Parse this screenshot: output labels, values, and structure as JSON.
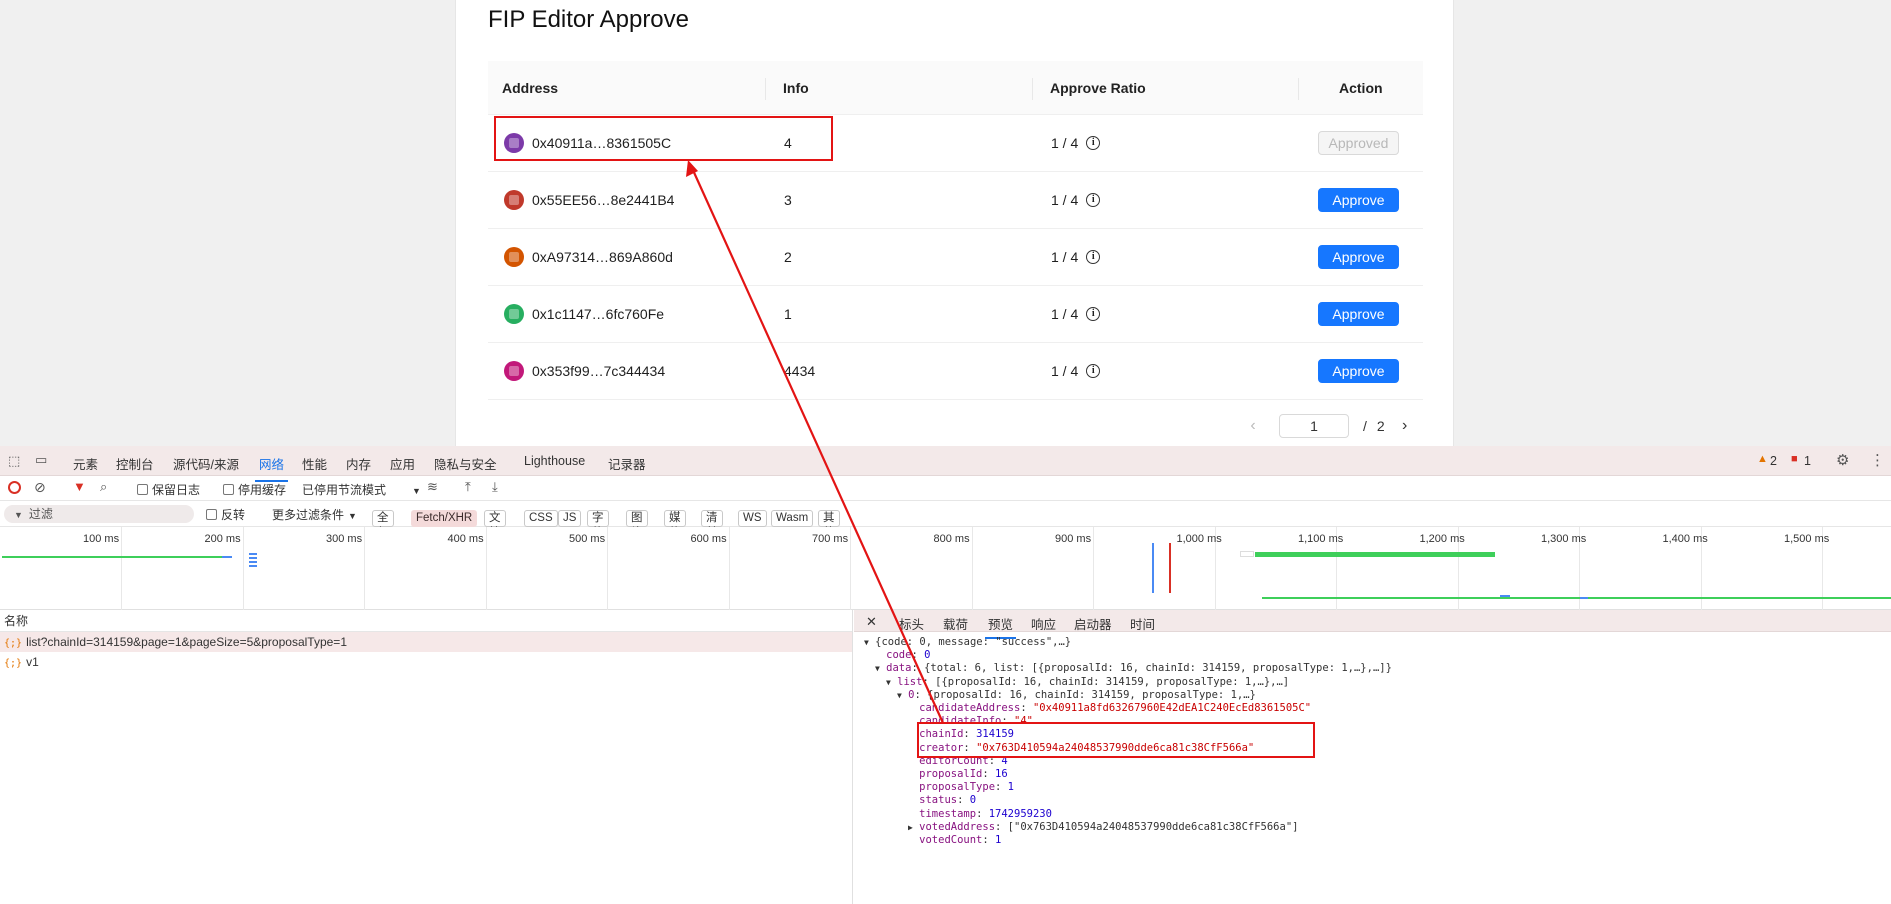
{
  "page": {
    "title": "FIP Editor Approve",
    "table": {
      "columns": [
        "Address",
        "Info",
        "Approve Ratio",
        "Action"
      ],
      "rows": [
        {
          "address": "0x40911a…8361505C",
          "info": "4",
          "ratio": "1 / 4",
          "action": "Approved",
          "state": "approved",
          "avatar_color": "#7c3aa8"
        },
        {
          "address": "0x55EE56…8e2441B4",
          "info": "3",
          "ratio": "1 / 4",
          "action": "Approve",
          "state": "approve",
          "avatar_color": "#c0392b"
        },
        {
          "address": "0xA97314…869A860d",
          "info": "2",
          "ratio": "1 / 4",
          "action": "Approve",
          "state": "approve",
          "avatar_color": "#d35400"
        },
        {
          "address": "0x1c1147…6fc760Fe",
          "info": "1",
          "ratio": "1 / 4",
          "action": "Approve",
          "state": "approve",
          "avatar_color": "#27ae60"
        },
        {
          "address": "0x353f99…7c344434",
          "info": "4434",
          "ratio": "1 / 4",
          "action": "Approve",
          "state": "approve",
          "avatar_color": "#c2187a"
        }
      ]
    },
    "pagination": {
      "prev_icon": "‹",
      "current": "1",
      "separator": "/",
      "total": "2",
      "next_icon": "›"
    }
  },
  "devtools": {
    "tabs": [
      "元素",
      "控制台",
      "源代码/来源",
      "网络",
      "性能",
      "内存",
      "应用",
      "隐私与安全",
      "Lighthouse",
      "记录器"
    ],
    "active_tab": "网络",
    "warnings": "2",
    "errors": "1",
    "toolbar": {
      "preserve_log": "保留日志",
      "disable_cache": "停用缓存",
      "throttle": "已停用节流模式"
    },
    "filter": {
      "placeholder": "过滤",
      "invert": "反转",
      "more_filters": "更多过滤条件",
      "chips": [
        "全部",
        "Fetch/XHR",
        "文档",
        "CSS",
        "JS",
        "字体",
        "图片",
        "媒体",
        "清单",
        "WS",
        "Wasm",
        "其他"
      ],
      "active_chip": "Fetch/XHR"
    },
    "timeline_labels": [
      "100 ms",
      "200 ms",
      "300 ms",
      "400 ms",
      "500 ms",
      "600 ms",
      "700 ms",
      "800 ms",
      "900 ms",
      "1,000 ms",
      "1,100 ms",
      "1,200 ms",
      "1,300 ms",
      "1,400 ms",
      "1,500 ms"
    ],
    "requests": {
      "header": "名称",
      "items": [
        "list?chainId=314159&page=1&pageSize=5&proposalType=1",
        "v1"
      ]
    },
    "detail": {
      "close_icon": "✕",
      "tabs": [
        "标头",
        "载荷",
        "预览",
        "响应",
        "启动器",
        "时间"
      ],
      "active_tab": "预览",
      "json_lines": [
        {
          "indent": 0,
          "tri": "▼",
          "text": "{code: 0, message: \"success\",…}"
        },
        {
          "indent": 1,
          "key": "code",
          "num": "0"
        },
        {
          "indent": 1,
          "tri": "▼",
          "key": "data",
          "text": "{total: 6, list: [{proposalId: 16, chainId: 314159, proposalType: 1,…},…]}"
        },
        {
          "indent": 2,
          "tri": "▼",
          "key": "list",
          "text": "[{proposalId: 16, chainId: 314159, proposalType: 1,…},…]"
        },
        {
          "indent": 3,
          "tri": "▼",
          "key": "0",
          "text": "{proposalId: 16, chainId: 314159, proposalType: 1,…}"
        },
        {
          "indent": 4,
          "key": "candidateAddress",
          "str": "\"0x40911a8fd63267960E42dEA1C240EcEd8361505C\""
        },
        {
          "indent": 4,
          "key": "candidateInfo",
          "str": "\"4\""
        },
        {
          "indent": 4,
          "key": "chainId",
          "num": "314159"
        },
        {
          "indent": 4,
          "key": "creator",
          "str": "\"0x763D410594a24048537990dde6ca81c38CfF566a\""
        },
        {
          "indent": 4,
          "key": "editorCount",
          "num": "4"
        },
        {
          "indent": 4,
          "key": "proposalId",
          "num": "16"
        },
        {
          "indent": 4,
          "key": "proposalType",
          "num": "1"
        },
        {
          "indent": 4,
          "key": "status",
          "num": "0"
        },
        {
          "indent": 4,
          "key": "timestamp",
          "num": "1742959230"
        },
        {
          "indent": 4,
          "tri": "▶",
          "key": "votedAddress",
          "text": "[\"0x763D410594a24048537990dde6ca81c38CfF566a\"]"
        },
        {
          "indent": 4,
          "key": "votedCount",
          "num": "1"
        }
      ]
    }
  }
}
